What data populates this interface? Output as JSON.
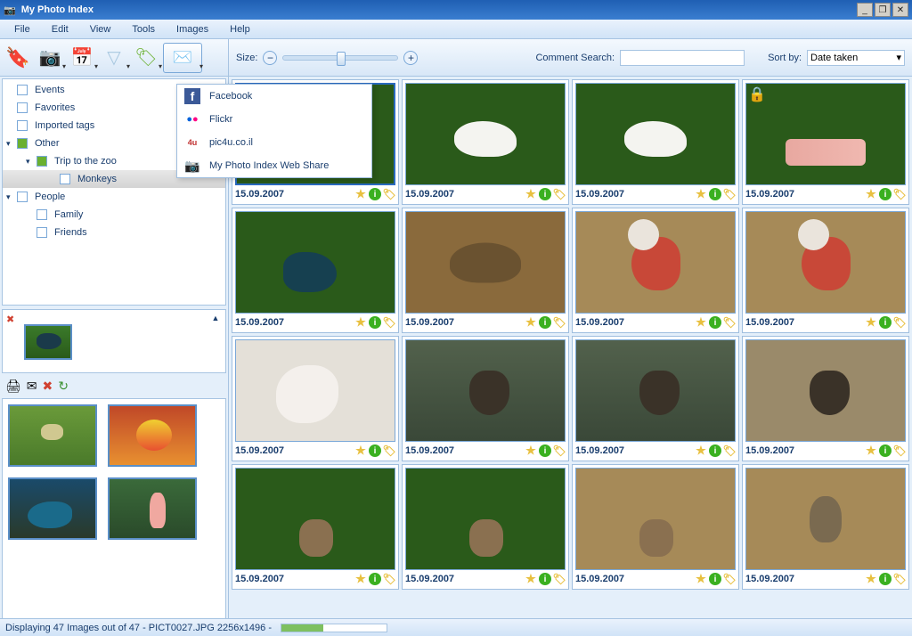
{
  "title": "My Photo Index",
  "menu": {
    "file": "File",
    "edit": "Edit",
    "view": "View",
    "tools": "Tools",
    "images": "Images",
    "help": "Help"
  },
  "toolbar": {
    "size_label": "Size:",
    "comment_label": "Comment Search:",
    "sort_label": "Sort by:",
    "sort_value": "Date taken"
  },
  "tree": {
    "events": "Events",
    "favorites": "Favorites",
    "imported": "Imported tags",
    "other": "Other",
    "trip": "Trip to the zoo",
    "monkeys": "Monkeys",
    "people": "People",
    "family": "Family",
    "friends": "Friends"
  },
  "share_menu": {
    "facebook": "Facebook",
    "flickr": "Flickr",
    "pic4u": "pic4u.co.il",
    "web": "My Photo Index Web Share"
  },
  "thumbs": {
    "date": "15.09.2007"
  },
  "status": {
    "text": "Displaying 47 Images out of 47   -   PICT0027.JPG 2256x1496   -"
  }
}
